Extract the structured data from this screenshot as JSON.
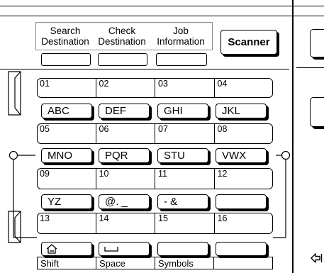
{
  "tabs": [
    {
      "line1": "Search",
      "line2": "Destination"
    },
    {
      "line1": "Check",
      "line2": "Destination"
    },
    {
      "line1": "Job",
      "line2": "Information"
    }
  ],
  "scanner_label": "Scanner",
  "destinations": [
    [
      "01",
      "02",
      "03",
      "04"
    ],
    [
      "05",
      "06",
      "07",
      "08"
    ],
    [
      "09",
      "10",
      "11",
      "12"
    ],
    [
      "13",
      "14",
      "15",
      "16"
    ]
  ],
  "index_keys": [
    [
      "ABC",
      "DEF",
      "GHI",
      "JKL"
    ],
    [
      "MNO",
      "PQR",
      "STU",
      "VWX"
    ],
    [
      "YZ",
      "@. _",
      "- &",
      ""
    ]
  ],
  "function_keys": [
    "Shift",
    "Space",
    "Symbols",
    ""
  ],
  "icons": {
    "shift_key": "home-shift-icon",
    "space_key": "space-bar-icon",
    "corner": "login-arrow-icon"
  }
}
